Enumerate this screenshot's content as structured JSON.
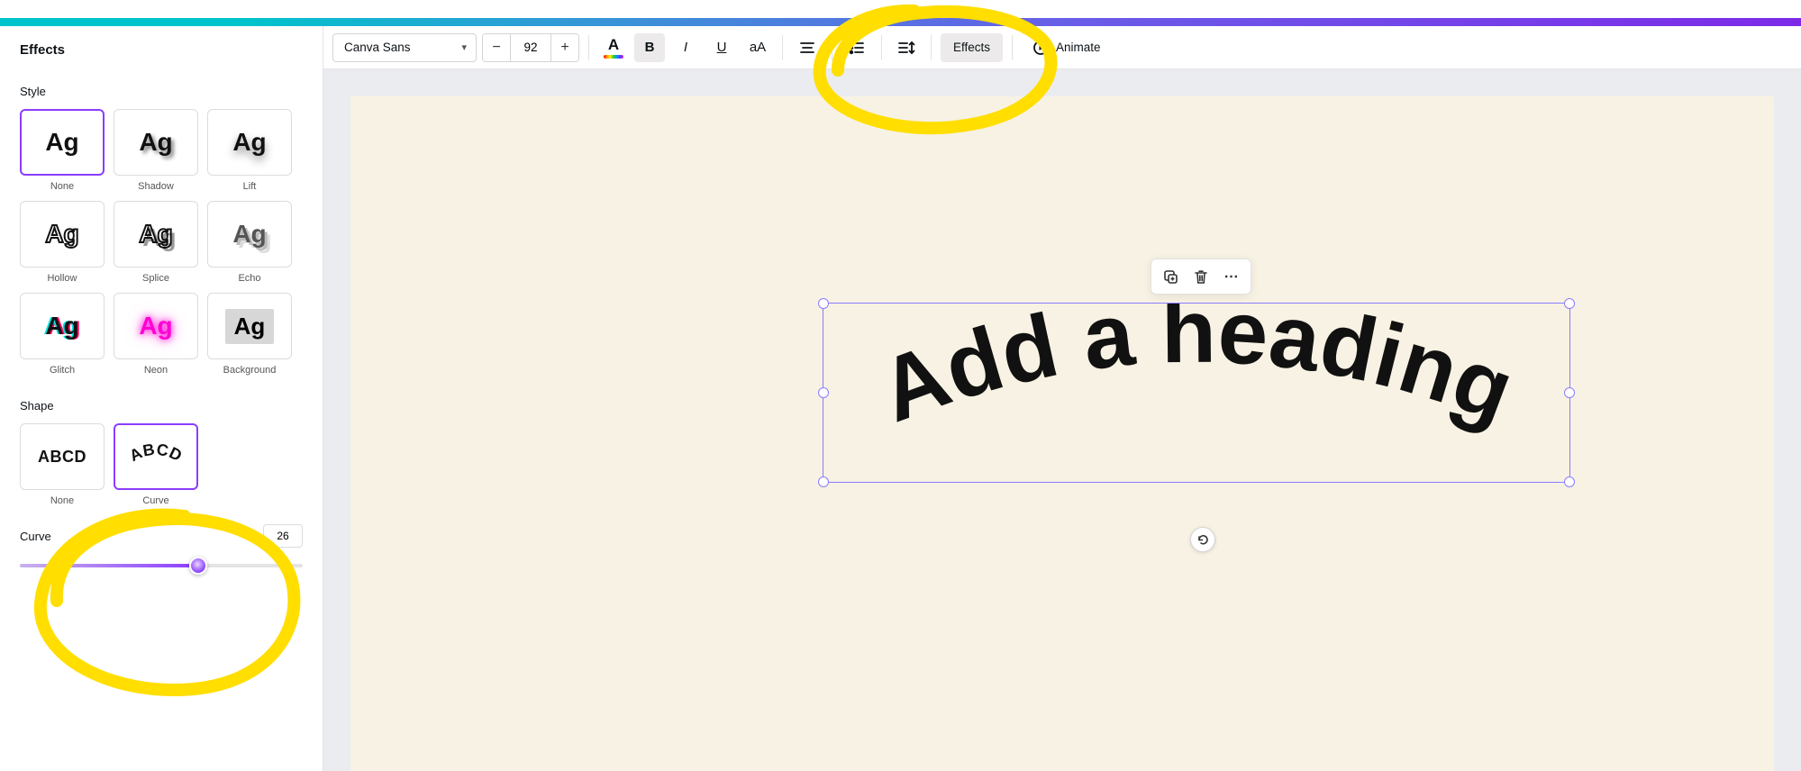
{
  "sidebar": {
    "title": "Effects",
    "style_label": "Style",
    "shape_label": "Shape",
    "styles": [
      {
        "label": "None",
        "ag": "Ag"
      },
      {
        "label": "Shadow",
        "ag": "Ag"
      },
      {
        "label": "Lift",
        "ag": "Ag"
      },
      {
        "label": "Hollow",
        "ag": "Ag"
      },
      {
        "label": "Splice",
        "ag": "Ag"
      },
      {
        "label": "Echo",
        "ag": "Ag"
      },
      {
        "label": "Glitch",
        "ag": "Ag"
      },
      {
        "label": "Neon",
        "ag": "Ag"
      },
      {
        "label": "Background",
        "ag": "Ag"
      }
    ],
    "shapes": [
      {
        "label": "None",
        "sample": "ABCD"
      },
      {
        "label": "Curve",
        "sample": "ABCD"
      }
    ],
    "curve": {
      "label": "Curve",
      "value": "26",
      "percent": 63
    }
  },
  "toolbar": {
    "font": "Canva Sans",
    "size": "92",
    "minus": "−",
    "plus": "+",
    "A": "A",
    "bold": "B",
    "italic": "I",
    "underline": "U",
    "case": "aA",
    "effects": "Effects",
    "animate": "Animate"
  },
  "canvas": {
    "heading_text": "Add a heading"
  },
  "float": {
    "more": "⋯"
  }
}
